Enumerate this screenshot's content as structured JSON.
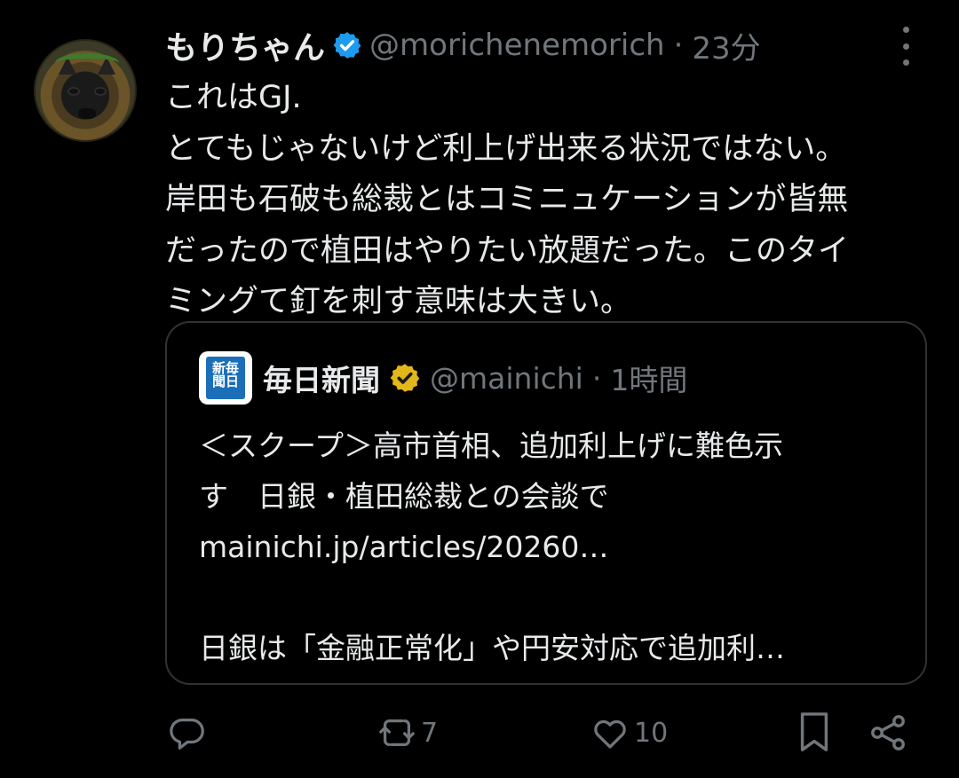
{
  "tweet": {
    "author_name": "もりちゃん",
    "handle": "@morichenemorich",
    "separator": "·",
    "time": "23分",
    "lines": [
      "これはGJ.",
      "とてもじゃないけど利上げ出来る状況ではない。",
      "岸田も石破も総裁とはコミニュケーションが皆無",
      "だったので植田はやりたい放題だった。このタイ",
      "ミングて釘を刺す意味は大きい。"
    ]
  },
  "quote": {
    "logo_text": "新毎\n聞日",
    "author_name": "毎日新聞",
    "handle": "@mainichi",
    "separator": "·",
    "time": "1時間",
    "lines": [
      "＜スクープ＞高市首相、追加利上げに難色示",
      "す　日銀・植田総裁との会談で",
      "mainichi.jp/articles/20260…",
      "",
      "日銀は「金融正常化」や円安対応で追加利…"
    ]
  },
  "actions": {
    "reply_count": "",
    "retweet_count": "7",
    "like_count": "10"
  },
  "colors": {
    "background": "#000000",
    "text": "#e7e9ea",
    "muted": "#71767b",
    "verified_blue": "#1d9bf0",
    "verified_gold": "#e2b719",
    "border": "#2f3336"
  },
  "icons": [
    "avatar",
    "verified-badge-icon",
    "more-icon",
    "newspaper-logo",
    "gold-verified-badge-icon",
    "reply-icon",
    "retweet-icon",
    "like-icon",
    "bookmark-icon",
    "share-icon"
  ]
}
